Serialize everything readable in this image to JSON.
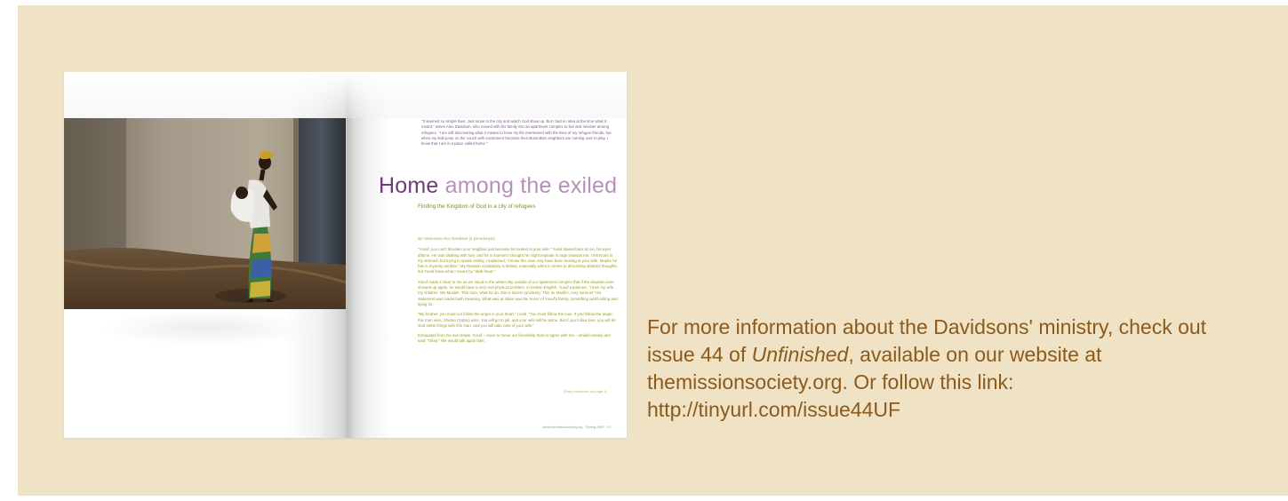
{
  "magazine": {
    "intro_quote": "\"It seemed so simple then. Just move to the city and watch God show up. But I had no idea at the time what it meant,\" writes Alex Davidson, who moved with his family into an apartment complex to live and minister among refugees. \"I am still discovering what it means to have my life intertwined with the lives of my refugee friends, but when my kids jump on the couch with excitement because their Burundian neighbors are coming over to play, I know that I am in a place called home.\"",
    "headline_word1": "Home",
    "headline_rest": " among the exiled",
    "subtitle": "Finding the Kingdom of God in a city of refugees",
    "byline": "By missionary Alex Davidson (a pseudonym)",
    "paragraphs": [
      "\"Yusuf, you can't threaten your neighbor just because he looked at your wife.\" Yusuf stared back at me, his eyes aflame. He was shaking with fury, and for a moment I thought he might explode in rage towards me. I felt knots in my stomach but trying to speak calmly, I explained, \"I know this man may have been looking at your wife. Maybe he has a chyorniy serdtse.\" My Russian vocabulary is limited, especially when it comes to describing abstract thoughts, but Yusuf knew what I meant by \"dark heart.\"",
      "Yusuf made it clear to me as we stood in the winter day outside of our apartment complex that if the situation ever showed up again, he would have a very real physical problem. In broken English, Yusuf explained, \"I love my wife, my children. We Muslim. This man, what he do, this is harem (unclean). This for Muslim, very serious!\" His statement was loaded with meaning. What was at stake was the honor of Yusuf's family, something worth killing and dying for.",
      "\"My brother, you must not follow the anger in your heart,\" I said. \"You must follow the love. If you follow the anger, this man wins, Shetan (Satan) wins. You will go to jail, and your wife will be alone. But if you follow love, you will let God settle things with this man, and you will take care of your wife.\"",
      "Exhausted from his own tirade, Yusuf – more to honor our friendship than to agree with me – smiled weakly and said, \"Okay.\" We would talk again later."
    ],
    "continued": "(Story continues on page 4)",
    "footer": "www.themissionsociety.org · Spring 2009 · 13"
  },
  "caption": {
    "text_before": "For more information about the Davidsons' ministry, check out issue 44 of ",
    "italic": "Unfinished",
    "text_after": ", available on our website at themissionsociety.org. Or follow this link: http://tinyurl.com/issue44UF"
  },
  "colors": {
    "panel_bg": "#f0e2c4",
    "caption_text": "#8b5a1c",
    "headline_dark": "#6d3e76",
    "headline_light": "#b691b7",
    "body_olive": "#9a9a2a"
  }
}
